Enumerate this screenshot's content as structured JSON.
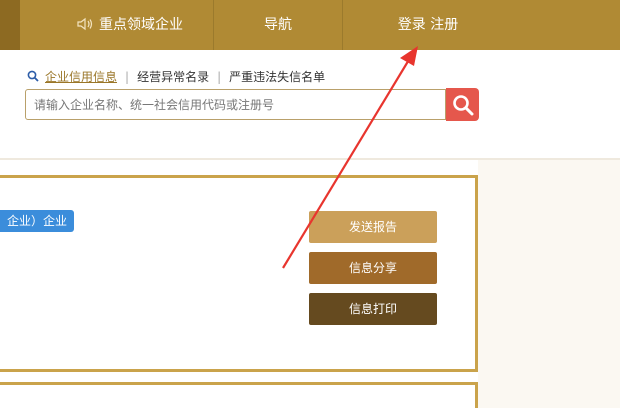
{
  "nav": {
    "items": [
      "重点领域企业",
      "导航",
      "登录 注册"
    ]
  },
  "search": {
    "tabs": [
      "企业信用信息",
      "经营异常名录",
      "严重违法失信名单"
    ],
    "separator": "|",
    "placeholder": "请输入企业名称、统一社会信用代码或注册号"
  },
  "card": {
    "badge": "企业）企业",
    "buttons": [
      "发送报告",
      "信息分享",
      "信息打印"
    ]
  },
  "colors": {
    "nav_bg": "#b08a34",
    "search_button": "#e5574c",
    "badge_bg": "#3b8ddb",
    "annotation_arrow": "#e8352e"
  },
  "icons": [
    "speaker-icon",
    "search-small-icon",
    "search-icon"
  ]
}
